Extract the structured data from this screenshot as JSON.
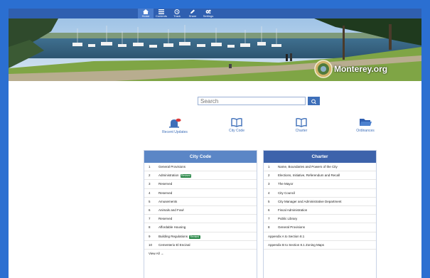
{
  "nav": {
    "items": [
      {
        "label": "Home",
        "icon": "home-icon",
        "active": true
      },
      {
        "label": "Contents",
        "icon": "list-icon",
        "active": false
      },
      {
        "label": "Track",
        "icon": "clock-icon",
        "active": false
      },
      {
        "label": "Share",
        "icon": "pen-icon",
        "active": false
      },
      {
        "label": "Settings",
        "icon": "gear-icon",
        "active": false
      }
    ]
  },
  "hero": {
    "brand": "Monterey.org"
  },
  "search": {
    "placeholder": "Search"
  },
  "quick_links": [
    {
      "label": "Recent Updates",
      "icon": "bell-icon"
    },
    {
      "label": "City Code",
      "icon": "book-icon"
    },
    {
      "label": "Charter",
      "icon": "book-icon"
    },
    {
      "label": "Ordinances",
      "icon": "folder-icon"
    }
  ],
  "city_code": {
    "title": "City Code",
    "rows": [
      {
        "num": "1",
        "label": "General Provisions",
        "badge": ""
      },
      {
        "num": "2",
        "label": "Administration",
        "badge": "Revised"
      },
      {
        "num": "3",
        "label": "Reserved",
        "badge": ""
      },
      {
        "num": "4",
        "label": "Reserved",
        "badge": ""
      },
      {
        "num": "5",
        "label": "Amusements",
        "badge": ""
      },
      {
        "num": "6",
        "label": "Animals and Fowl",
        "badge": ""
      },
      {
        "num": "7",
        "label": "Reserved",
        "badge": ""
      },
      {
        "num": "8",
        "label": "Affordable Housing",
        "badge": ""
      },
      {
        "num": "9",
        "label": "Building Regulations",
        "badge": "Revised"
      },
      {
        "num": "10",
        "label": "Cementerio El Encinal",
        "badge": ""
      }
    ],
    "view_all": "View All →"
  },
  "charter": {
    "title": "Charter",
    "rows": [
      {
        "num": "1",
        "label": "Name, Boundaries and Powers of the City"
      },
      {
        "num": "2",
        "label": "Elections, Initiative, Referendum and Recall"
      },
      {
        "num": "3",
        "label": "The Mayor"
      },
      {
        "num": "4",
        "label": "City Council"
      },
      {
        "num": "5",
        "label": "City Manager and Administrative Department"
      },
      {
        "num": "6",
        "label": "Fiscal Administration"
      },
      {
        "num": "7",
        "label": "Public Library"
      },
      {
        "num": "8",
        "label": "General Provisions"
      },
      {
        "num": "",
        "label": "Appendix A to Section 8.1"
      },
      {
        "num": "",
        "label": "Appendix B to Section 8.1 Zoning Maps"
      }
    ]
  },
  "colors": {
    "frame": "#2b6fd1",
    "nav": "#2f5fb0",
    "accent": "#3e6fb9",
    "city_code_header": "#5b86c6",
    "charter_header": "#3d63ab",
    "badge": "#2d8a4b",
    "alert": "#d93a3a"
  }
}
